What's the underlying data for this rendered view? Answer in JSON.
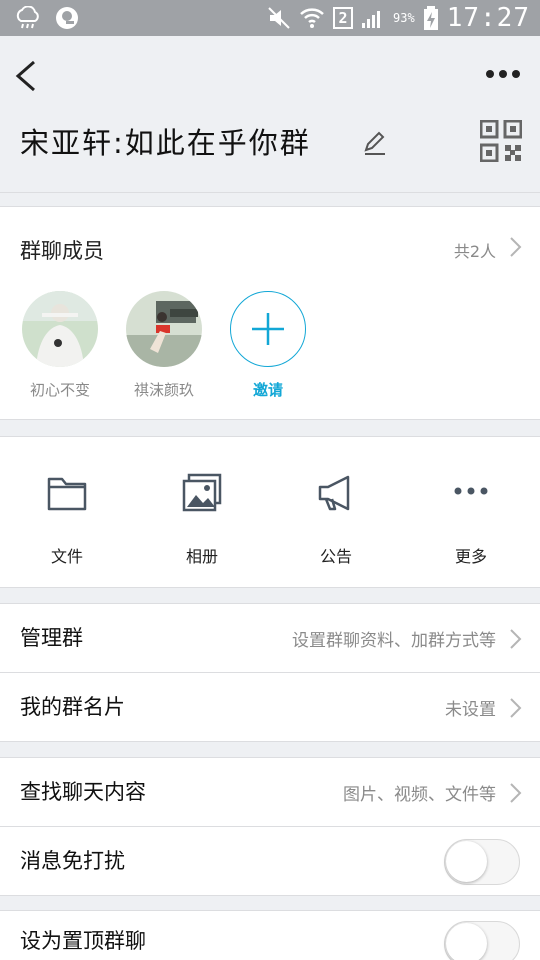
{
  "status_bar": {
    "sim_slot": "2",
    "battery_percent": "93%",
    "time": "17:27"
  },
  "header": {
    "group_title": "宋亚轩:如此在乎你群"
  },
  "members": {
    "title": "群聊成员",
    "count_text": "共2人",
    "list": [
      {
        "name": "初心不变"
      },
      {
        "name": "祺沫颜玖"
      }
    ],
    "invite_label": "邀请"
  },
  "tools": [
    {
      "label": "文件",
      "icon": "folder-icon"
    },
    {
      "label": "相册",
      "icon": "album-icon"
    },
    {
      "label": "公告",
      "icon": "megaphone-icon"
    },
    {
      "label": "更多",
      "icon": "more-dots-icon"
    }
  ],
  "settings": {
    "manage_group": {
      "label": "管理群",
      "value": "设置群聊资料、加群方式等"
    },
    "my_group_card": {
      "label": "我的群名片",
      "value": "未设置"
    },
    "search_history": {
      "label": "查找聊天内容",
      "value": "图片、视频、文件等"
    },
    "mute": {
      "label": "消息免打扰",
      "on": false
    },
    "pin": {
      "label": "设为置顶群聊",
      "on": false
    }
  },
  "colors": {
    "accent": "#12a7d6",
    "status_bar": "#9fa2a6",
    "background": "#eef0f3"
  }
}
